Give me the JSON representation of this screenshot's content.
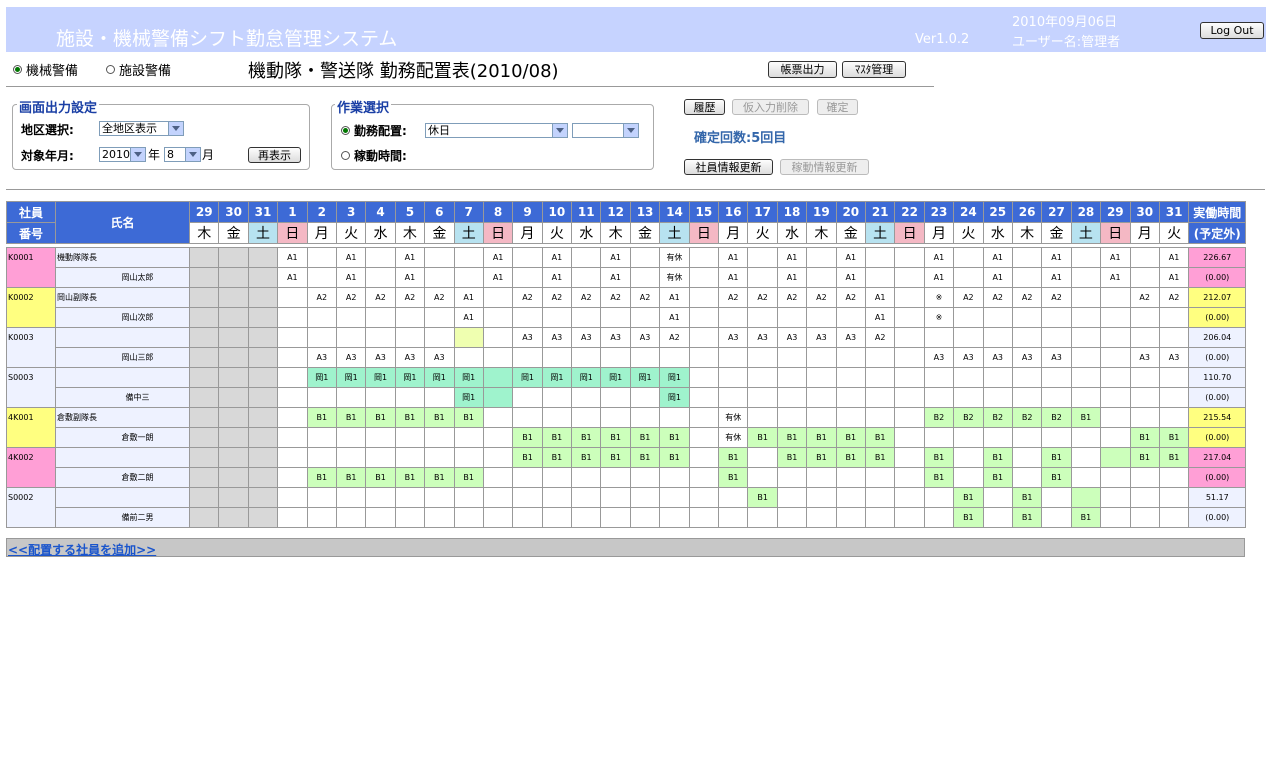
{
  "header": {
    "title": "施設・機械警備シフト勤怠管理システム",
    "version": "Ver1.0.2",
    "date": "2010年09月06日",
    "user": "ユーザー名:管理者",
    "logout_label": "Log Out"
  },
  "mode": {
    "option_machine": "機械警備",
    "option_facility": "施設警備",
    "selected": "機械警備"
  },
  "page_title": "機動隊・警送隊 勤務配置表(2010/08)",
  "toolbar": {
    "report_label": "帳票出力",
    "master_label": "ﾏｽﾀ管理"
  },
  "display_settings": {
    "legend": "画面出力設定",
    "area_label": "地区選択:",
    "area_value": "全地区表示",
    "period_label": "対象年月:",
    "year_value": "2010",
    "year_unit": "年",
    "month_value": "8",
    "month_unit": "月",
    "redisplay_label": "再表示"
  },
  "work_select": {
    "legend": "作業選択",
    "duty_label": "勤務配置:",
    "duty_value": "休日",
    "duty_value2": "",
    "move_label": "稼動時間:"
  },
  "actions": {
    "history_label": "履歴",
    "delete_label": "仮入力削除",
    "confirm_label": "確定",
    "confirm_count": "確定回数:5回目",
    "staff_update_label": "社員情報更新",
    "activity_update_label": "稼動情報更新"
  },
  "table": {
    "col_id_top": "社員",
    "col_id_bottom": "番号",
    "col_name": "氏名",
    "col_total_top": "実働時間",
    "col_total_bottom": "(予定外)",
    "days": [
      {
        "d": "29",
        "w": "木"
      },
      {
        "d": "30",
        "w": "金"
      },
      {
        "d": "31",
        "w": "土"
      },
      {
        "d": "1",
        "w": "日"
      },
      {
        "d": "2",
        "w": "月"
      },
      {
        "d": "3",
        "w": "火"
      },
      {
        "d": "4",
        "w": "水"
      },
      {
        "d": "5",
        "w": "木"
      },
      {
        "d": "6",
        "w": "金"
      },
      {
        "d": "7",
        "w": "土"
      },
      {
        "d": "8",
        "w": "日"
      },
      {
        "d": "9",
        "w": "月"
      },
      {
        "d": "10",
        "w": "火"
      },
      {
        "d": "11",
        "w": "水"
      },
      {
        "d": "12",
        "w": "木"
      },
      {
        "d": "13",
        "w": "金"
      },
      {
        "d": "14",
        "w": "土"
      },
      {
        "d": "15",
        "w": "日"
      },
      {
        "d": "16",
        "w": "月"
      },
      {
        "d": "17",
        "w": "火"
      },
      {
        "d": "18",
        "w": "水"
      },
      {
        "d": "19",
        "w": "木"
      },
      {
        "d": "20",
        "w": "金"
      },
      {
        "d": "21",
        "w": "土"
      },
      {
        "d": "22",
        "w": "日"
      },
      {
        "d": "23",
        "w": "月"
      },
      {
        "d": "24",
        "w": "火"
      },
      {
        "d": "25",
        "w": "水"
      },
      {
        "d": "26",
        "w": "木"
      },
      {
        "d": "27",
        "w": "金"
      },
      {
        "d": "28",
        "w": "土"
      },
      {
        "d": "29",
        "w": "日"
      },
      {
        "d": "30",
        "w": "月"
      },
      {
        "d": "31",
        "w": "火"
      }
    ],
    "employees": [
      {
        "id": "K0001",
        "title": "機動隊隊長",
        "name": "岡山太郎",
        "id_color": "#ff9fd6",
        "total": "226.67",
        "total_color": "#ff9fd6",
        "overtime": "(0.00)",
        "overtime_color": "#ff9fd6",
        "row1": [
          "",
          "",
          "",
          "A1",
          "",
          "A1",
          "",
          "A1",
          "",
          "",
          "A1",
          "",
          "A1",
          "",
          "A1",
          "",
          "有休",
          "",
          "A1",
          "",
          "A1",
          "",
          "A1",
          "",
          "",
          "A1",
          "",
          "A1",
          "",
          "A1",
          "",
          "A1",
          "",
          "A1"
        ],
        "row2": [
          "",
          "",
          "",
          "A1",
          "",
          "A1",
          "",
          "A1",
          "",
          "",
          "A1",
          "",
          "A1",
          "",
          "A1",
          "",
          "有休",
          "",
          "A1",
          "",
          "A1",
          "",
          "A1",
          "",
          "",
          "A1",
          "",
          "A1",
          "",
          "A1",
          "",
          "A1",
          "",
          "A1"
        ],
        "fill1": {},
        "fill2": {}
      },
      {
        "id": "K0002",
        "title": "岡山副隊長",
        "name": "岡山次郎",
        "id_color": "#ffff80",
        "total": "212.07",
        "total_color": "#ffff80",
        "overtime": "(0.00)",
        "overtime_color": "#ffff80",
        "row1": [
          "",
          "",
          "",
          "",
          "A2",
          "A2",
          "A2",
          "A2",
          "A2",
          "A1",
          "",
          "A2",
          "A2",
          "A2",
          "A2",
          "A2",
          "A1",
          "",
          "A2",
          "A2",
          "A2",
          "A2",
          "A2",
          "A1",
          "",
          "※",
          "A2",
          "A2",
          "A2",
          "A2",
          "",
          "",
          "A2",
          "A2"
        ],
        "row2": [
          "",
          "",
          "",
          "",
          "",
          "",
          "",
          "",
          "",
          "A1",
          "",
          "",
          "",
          "",
          "",
          "",
          "A1",
          "",
          "",
          "",
          "",
          "",
          "",
          "A1",
          "",
          "※",
          "",
          "",
          "",
          "",
          "",
          "",
          "",
          ""
        ],
        "fill1": {},
        "fill2": {}
      },
      {
        "id": "K0003",
        "title": "",
        "name": "岡山三郎",
        "id_color": "#eef2ff",
        "total": "206.04",
        "total_color": "#eef2ff",
        "overtime": "(0.00)",
        "overtime_color": "#eef2ff",
        "row1": [
          "",
          "",
          "",
          "",
          "",
          "",
          "",
          "",
          "",
          "",
          "",
          "A3",
          "A3",
          "A3",
          "A3",
          "A3",
          "A2",
          "",
          "A3",
          "A3",
          "A3",
          "A3",
          "A3",
          "A2",
          "",
          "",
          "",
          "",
          "",
          "",
          "",
          "",
          "",
          ""
        ],
        "row2": [
          "",
          "",
          "",
          "",
          "A3",
          "A3",
          "A3",
          "A3",
          "A3",
          "",
          "",
          "",
          "",
          "",
          "",
          "",
          "",
          "",
          "",
          "",
          "",
          "",
          "",
          "",
          "",
          "A3",
          "A3",
          "A3",
          "A3",
          "A3",
          "",
          "",
          "A3",
          "A3"
        ],
        "fill1": {
          "9": "y"
        },
        "fill2": {}
      },
      {
        "id": "S0003",
        "title": "",
        "name": "備中三",
        "id_color": "#eef2ff",
        "total": "110.70",
        "total_color": "#eef2ff",
        "overtime": "(0.00)",
        "overtime_color": "#eef2ff",
        "row1": [
          "",
          "",
          "",
          "",
          "岡1",
          "岡1",
          "岡1",
          "岡1",
          "岡1",
          "岡1",
          "",
          "岡1",
          "岡1",
          "岡1",
          "岡1",
          "岡1",
          "岡1",
          "",
          "",
          "",
          "",
          "",
          "",
          "",
          "",
          "",
          "",
          "",
          "",
          "",
          "",
          "",
          "",
          ""
        ],
        "row2": [
          "",
          "",
          "",
          "",
          "",
          "",
          "",
          "",
          "",
          "岡1",
          "",
          "",
          "",
          "",
          "",
          "",
          "岡1",
          "",
          "",
          "",
          "",
          "",
          "",
          "",
          "",
          "",
          "",
          "",
          "",
          "",
          "",
          "",
          "",
          ""
        ],
        "fill1": {
          "4": "t",
          "5": "t",
          "6": "t",
          "7": "t",
          "8": "t",
          "9": "t",
          "10": "t",
          "11": "t",
          "12": "t",
          "13": "t",
          "14": "t",
          "15": "t",
          "16": "t"
        },
        "fill2": {
          "9": "t",
          "10": "t",
          "16": "t"
        }
      },
      {
        "id": "4K001",
        "title": "倉敷副隊長",
        "name": "倉敷一朗",
        "id_color": "#ffff80",
        "total": "215.54",
        "total_color": "#ffff80",
        "overtime": "(0.00)",
        "overtime_color": "#ffff80",
        "row1": [
          "",
          "",
          "",
          "",
          "B1",
          "B1",
          "B1",
          "B1",
          "B1",
          "B1",
          "",
          "",
          "",
          "",
          "",
          "",
          "",
          "",
          "有休",
          "",
          "",
          "",
          "",
          "",
          "",
          "B2",
          "B2",
          "B2",
          "B2",
          "B2",
          "B1",
          "",
          "",
          ""
        ],
        "row2": [
          "",
          "",
          "",
          "",
          "",
          "",
          "",
          "",
          "",
          "",
          "",
          "B1",
          "B1",
          "B1",
          "B1",
          "B1",
          "B1",
          "",
          "有休",
          "B1",
          "B1",
          "B1",
          "B1",
          "B1",
          "",
          "",
          "",
          "",
          "",
          "",
          "",
          "",
          "B1",
          "B1"
        ],
        "fill1": {
          "4": "g",
          "5": "g",
          "6": "g",
          "7": "g",
          "8": "g",
          "9": "g",
          "25": "g",
          "26": "g",
          "27": "g",
          "28": "g",
          "29": "g",
          "30": "g"
        },
        "fill2": {
          "11": "g",
          "12": "g",
          "13": "g",
          "14": "g",
          "15": "g",
          "16": "g",
          "19": "g",
          "20": "g",
          "21": "g",
          "22": "g",
          "23": "g",
          "32": "g",
          "33": "g"
        }
      },
      {
        "id": "4K002",
        "title": "",
        "name": "倉敷二朗",
        "id_color": "#ff9fd6",
        "total": "217.04",
        "total_color": "#ff9fd6",
        "overtime": "(0.00)",
        "overtime_color": "#ff9fd6",
        "row1": [
          "",
          "",
          "",
          "",
          "",
          "",
          "",
          "",
          "",
          "",
          "",
          "B1",
          "B1",
          "B1",
          "B1",
          "B1",
          "B1",
          "",
          "B1",
          "",
          "B1",
          "B1",
          "B1",
          "B1",
          "",
          "B1",
          "",
          "B1",
          "",
          "B1",
          "",
          "",
          "B1",
          "B1"
        ],
        "row2": [
          "",
          "",
          "",
          "",
          "B1",
          "B1",
          "B1",
          "B1",
          "B1",
          "B1",
          "",
          "",
          "",
          "",
          "",
          "",
          "",
          "",
          "B1",
          "",
          "",
          "",
          "",
          "",
          "",
          "B1",
          "",
          "B1",
          "",
          "B1",
          "",
          "",
          "",
          ""
        ],
        "fill1": {
          "11": "g",
          "12": "g",
          "13": "g",
          "14": "g",
          "15": "g",
          "16": "g",
          "18": "g",
          "20": "g",
          "21": "g",
          "22": "g",
          "23": "g",
          "25": "g",
          "27": "g",
          "29": "g",
          "31": "g",
          "32": "g",
          "33": "g"
        },
        "fill2": {
          "4": "g",
          "5": "g",
          "6": "g",
          "7": "g",
          "8": "g",
          "9": "g",
          "18": "g",
          "25": "g",
          "27": "g",
          "29": "g"
        }
      },
      {
        "id": "S0002",
        "title": "",
        "name": "備前二男",
        "id_color": "#eef2ff",
        "total": "51.17",
        "total_color": "#eef2ff",
        "overtime": "(0.00)",
        "overtime_color": "#eef2ff",
        "row1": [
          "",
          "",
          "",
          "",
          "",
          "",
          "",
          "",
          "",
          "",
          "",
          "",
          "",
          "",
          "",
          "",
          "",
          "",
          "",
          "B1",
          "",
          "",
          "",
          "",
          "",
          "",
          "B1",
          "",
          "B1",
          "",
          "",
          "",
          "",
          ""
        ],
        "row2": [
          "",
          "",
          "",
          "",
          "",
          "",
          "",
          "",
          "",
          "",
          "",
          "",
          "",
          "",
          "",
          "",
          "",
          "",
          "",
          "",
          "",
          "",
          "",
          "",
          "",
          "",
          "B1",
          "",
          "B1",
          "",
          "B1",
          "",
          "",
          ""
        ],
        "fill1": {
          "19": "g",
          "26": "g",
          "28": "g",
          "30": "g"
        },
        "fill2": {
          "26": "g",
          "28": "g",
          "30": "g"
        }
      }
    ],
    "add_link": "<<配置する社員を追加>>"
  }
}
